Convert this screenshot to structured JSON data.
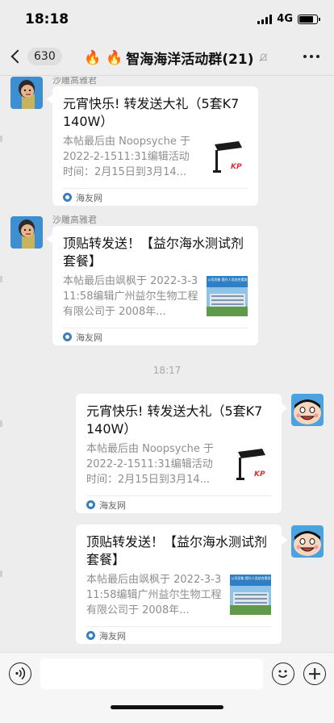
{
  "status_bar": {
    "time": "18:18",
    "network": "4G"
  },
  "nav": {
    "unread_count": "630",
    "title_emoji": "🔥 🔥",
    "title": "智海海洋活动群(21)"
  },
  "messages": [
    {
      "sender": "沙雕高雅君",
      "title": "元宵快乐! 转发送大礼（5套K7  140W）",
      "desc": "本帖最后由 Noopsyche 于 2022-2-1511:31编辑活动时间：2月15日到3月14...",
      "source": "海友网",
      "thumb_text": "KP"
    },
    {
      "sender": "沙雕高雅君",
      "title": "顶贴转发送！【益尔海水测试剂套餐】",
      "desc": "本帖最后由飒枫于 2022-3-311:58编辑广州益尔生物工程有限公司于 2008年...",
      "source": "海友网",
      "thumb_text": "公司形象 提升人员综合素质"
    },
    {
      "title": "元宵快乐! 转发送大礼（5套K7  140W）",
      "desc": "本帖最后由 Noopsyche 于 2022-2-1511:31编辑活动时间：2月15日到3月14...",
      "source": "海友网",
      "thumb_text": "KP"
    },
    {
      "title": "顶贴转发送！【益尔海水测试剂套餐】",
      "desc": "本帖最后由飒枫于 2022-3-311:58编辑广州益尔生物工程有限公司于 2008年...",
      "source": "海友网",
      "thumb_text": "公司形象 提升人员综合素质"
    }
  ],
  "timestamp": "18:17",
  "input": {
    "placeholder": ""
  },
  "colors": {
    "background": "#ededed",
    "card": "#ffffff",
    "muted_text": "#8e8e8e"
  }
}
